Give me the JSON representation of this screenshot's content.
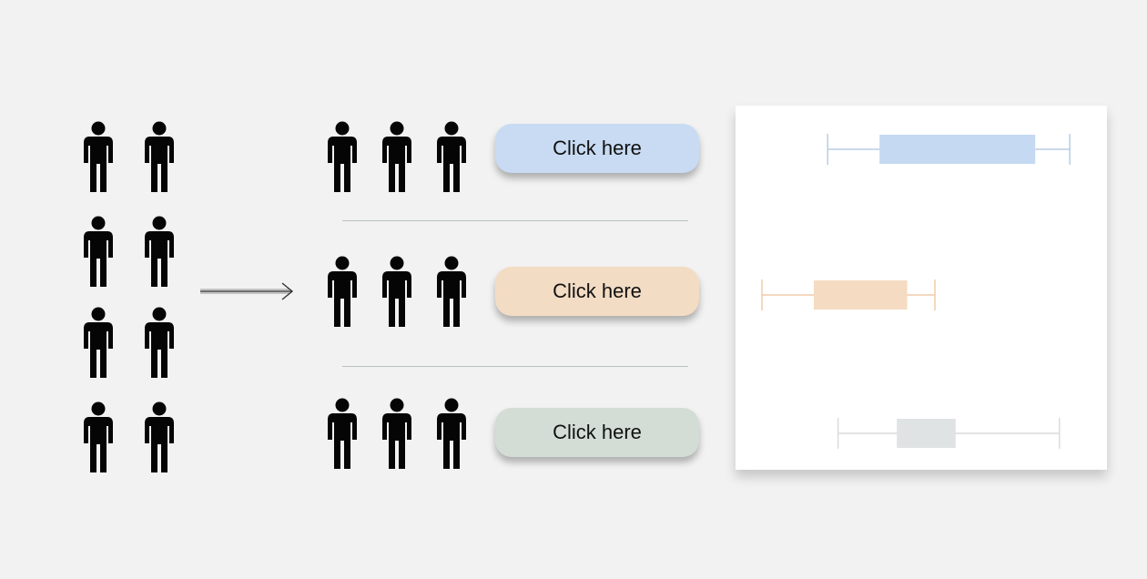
{
  "population": {
    "icon": "person-icon",
    "count": 8
  },
  "arrow": {
    "icon": "arrow-right-icon"
  },
  "groups": [
    {
      "id": "a",
      "icon": "person-icon",
      "count": 3,
      "button_label": "Click here",
      "color": "#c8dbf3"
    },
    {
      "id": "b",
      "icon": "person-icon",
      "count": 3,
      "button_label": "Click here",
      "color": "#f3dcc4"
    },
    {
      "id": "c",
      "icon": "person-icon",
      "count": 3,
      "button_label": "Click here",
      "color": "#d3ddd6"
    }
  ],
  "chart_data": {
    "type": "boxplot",
    "series": [
      {
        "whisker_low": 0.24,
        "q1": 0.39,
        "q3": 0.84,
        "whisker_high": 0.94,
        "color": "#c5d9f2",
        "line_color": "#b8cde6"
      },
      {
        "whisker_low": 0.05,
        "q1": 0.2,
        "q3": 0.47,
        "whisker_high": 0.55,
        "color": "#f5dbc2",
        "line_color": "#f0ccab"
      },
      {
        "whisker_low": 0.27,
        "q1": 0.44,
        "q3": 0.61,
        "whisker_high": 0.91,
        "color": "#dfe3e3",
        "line_color": "#d9dcdc"
      }
    ]
  }
}
